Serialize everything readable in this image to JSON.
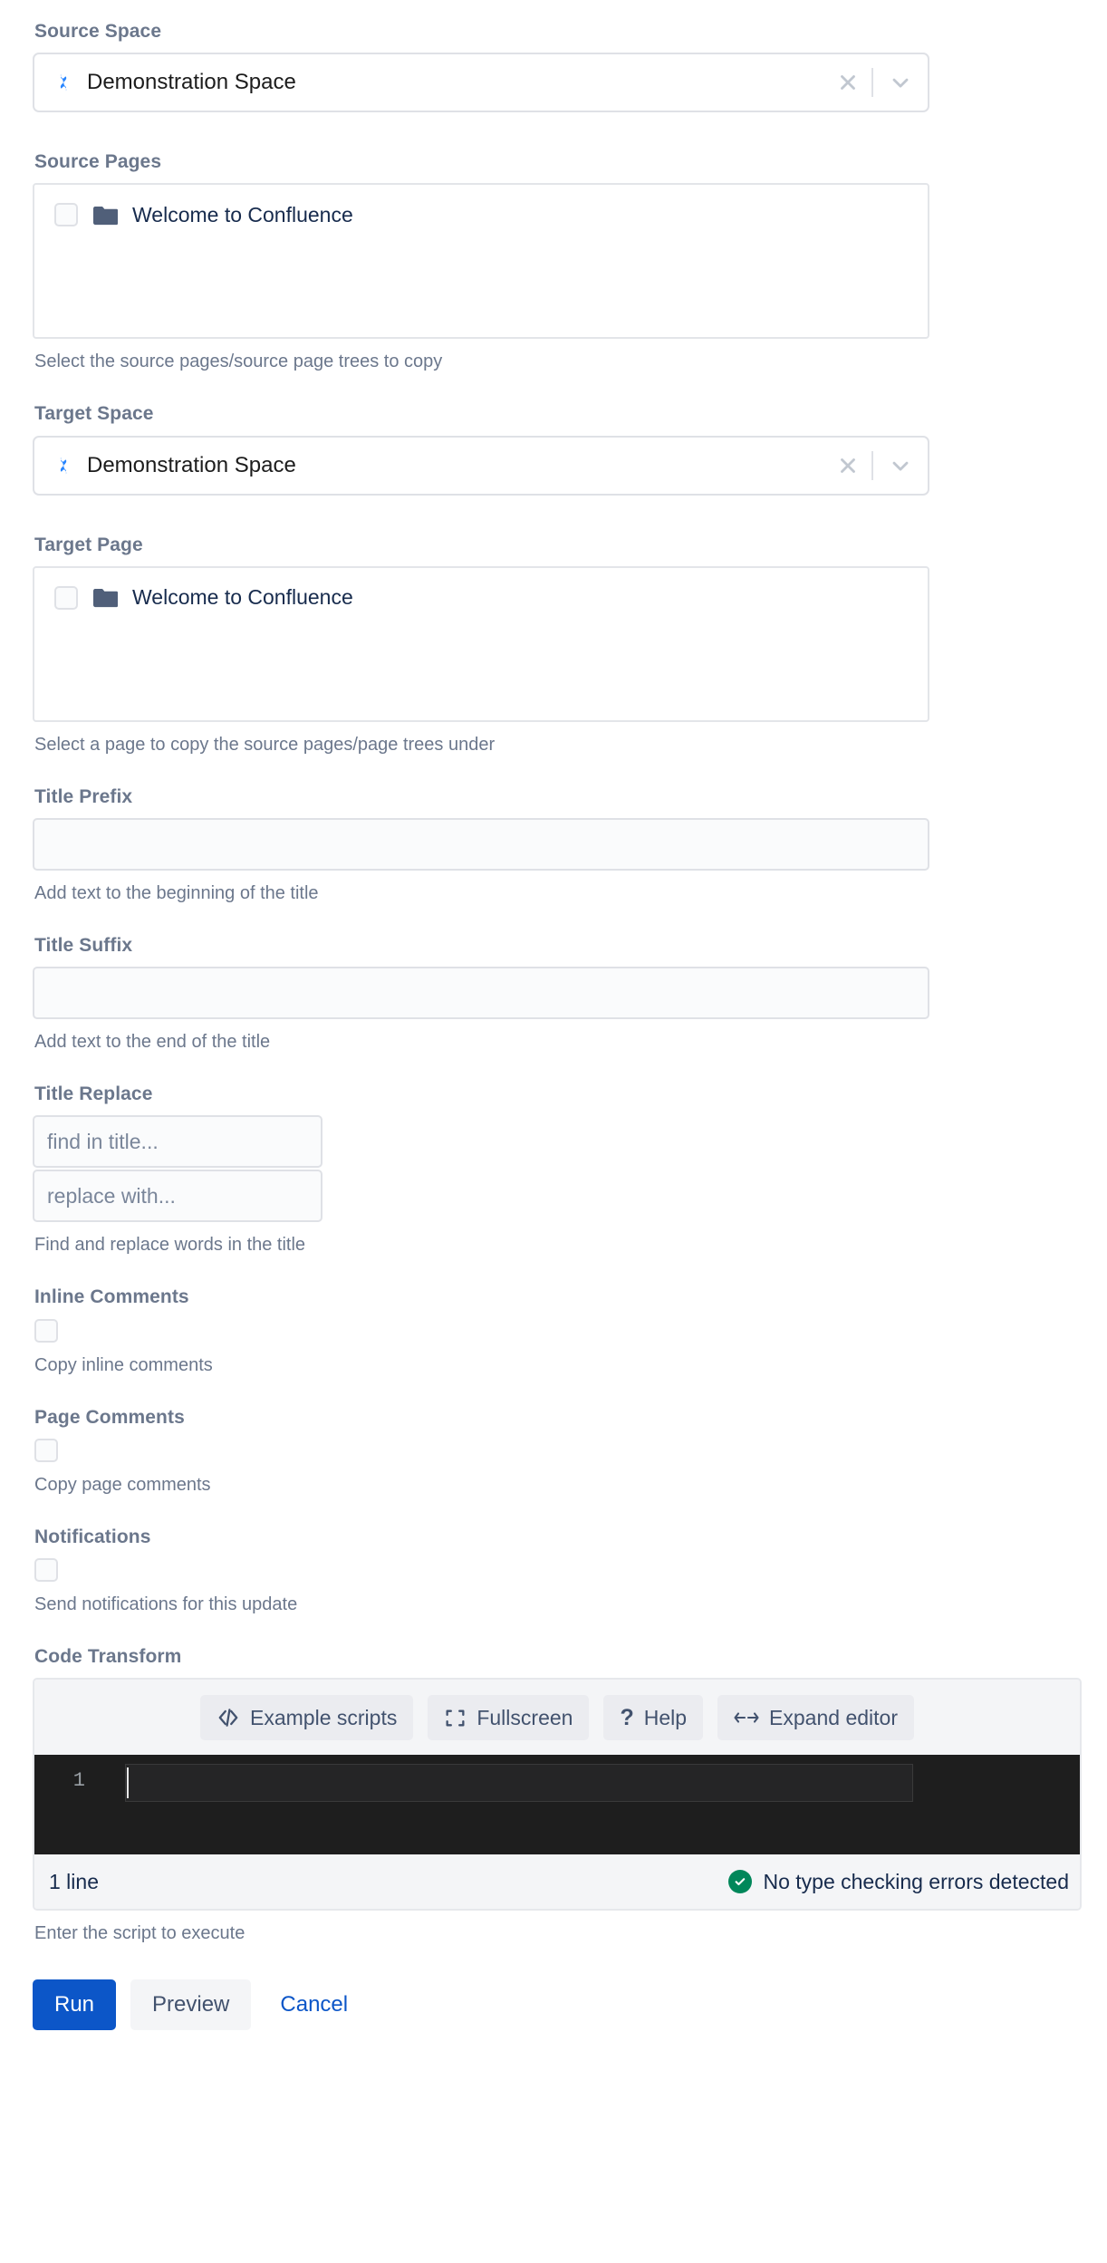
{
  "form": {
    "source_space": {
      "label": "Source Space",
      "value": "Demonstration Space",
      "space_icon": "confluence-space-icon",
      "clear_icon": "close-icon",
      "dropdown_icon": "chevron-down-icon"
    },
    "source_pages": {
      "label": "Source Pages",
      "help": "Select the source pages/source page trees to copy",
      "items": [
        {
          "label": "Welcome to Confluence",
          "icon": "folder-icon",
          "checked": false
        }
      ]
    },
    "target_space": {
      "label": "Target Space",
      "value": "Demonstration Space",
      "space_icon": "confluence-space-icon",
      "clear_icon": "close-icon",
      "dropdown_icon": "chevron-down-icon"
    },
    "target_page": {
      "label": "Target Page",
      "help": "Select a page to copy the source pages/page trees under",
      "items": [
        {
          "label": "Welcome to Confluence",
          "icon": "folder-icon",
          "checked": false
        }
      ]
    },
    "title_prefix": {
      "label": "Title Prefix",
      "value": "",
      "placeholder": "",
      "help": "Add text to the beginning of the title"
    },
    "title_suffix": {
      "label": "Title Suffix",
      "value": "",
      "placeholder": "",
      "help": "Add text to the end of the title"
    },
    "title_replace": {
      "label": "Title Replace",
      "find_value": "",
      "find_placeholder": "find in title...",
      "replace_value": "",
      "replace_placeholder": "replace with...",
      "help": "Find and replace words in the title"
    },
    "inline_comments": {
      "label": "Inline Comments",
      "help": "Copy inline comments",
      "checked": false
    },
    "page_comments": {
      "label": "Page Comments",
      "help": "Copy page comments",
      "checked": false
    },
    "notifications": {
      "label": "Notifications",
      "help": "Send notifications for this update",
      "checked": false
    },
    "code_transform": {
      "label": "Code Transform",
      "help": "Enter the script to execute",
      "toolbar": [
        {
          "label": "Example scripts",
          "icon": "code-brackets-icon"
        },
        {
          "label": "Fullscreen",
          "icon": "fullscreen-icon"
        },
        {
          "label": "Help",
          "icon": "question-mark-icon"
        },
        {
          "label": "Expand editor",
          "icon": "left-right-arrows-icon"
        }
      ],
      "editor": {
        "line_numbers": [
          "1"
        ],
        "content": ""
      },
      "status": {
        "lines": "1 line",
        "validation": "No type checking errors detected",
        "validation_icon": "check-circle-icon"
      }
    }
  },
  "actions": {
    "run": "Run",
    "preview": "Preview",
    "cancel": "Cancel"
  },
  "colors": {
    "primary": "#0C56C8",
    "label": "#6B778C",
    "text": "#172B4D",
    "space_icon": "#2684FF",
    "folder": "#505F79",
    "success": "#00875A",
    "editor_bg": "#1E1E1E"
  }
}
